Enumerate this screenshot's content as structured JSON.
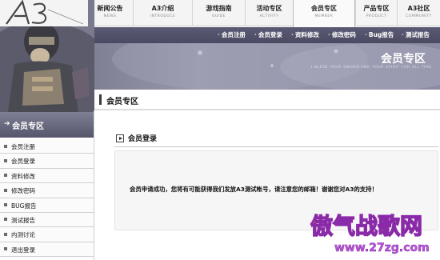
{
  "nav": {
    "items": [
      {
        "cn": "新闻公告",
        "en": "NEWS"
      },
      {
        "cn": "A3介绍",
        "en": "INTRODUCE"
      },
      {
        "cn": "游戏指南",
        "en": "GUIDE"
      },
      {
        "cn": "活动专区",
        "en": "ACTIVITY"
      },
      {
        "cn": "会员专区",
        "en": "MEMBER"
      },
      {
        "cn": "产品专区",
        "en": "PRODUCT"
      },
      {
        "cn": "A3社区",
        "en": "COMMUNITY"
      }
    ],
    "active_index": 4
  },
  "subnav": {
    "links": [
      "会员注册",
      "会员登录",
      "资料修改",
      "修改密码",
      "Bug报告",
      "测试报告"
    ]
  },
  "banner": {
    "title": "会员专区",
    "slogan": "I BLESS YOUR SWORD AND YOUR SPIRIT FOR ALL TIME"
  },
  "logo_text": "A3",
  "section": {
    "title": "会员专区"
  },
  "sidebar": {
    "title": "会员专区",
    "items": [
      "会员注册",
      "会员登录",
      "资料修改",
      "修改密码",
      "BUG报告",
      "测试报告",
      "内测讨论",
      "退出登录"
    ]
  },
  "main": {
    "login_title": "会员登录",
    "message": "会员申请成功，您将有可能获得我们发放A3测试帐号，请注意您的邮箱！谢谢您对A3的支持！"
  },
  "watermark": {
    "text_cn": "傲气战歌网",
    "url": "www.27zg.com"
  },
  "colors": {
    "banner_dark": "#55556c",
    "watermark_orange": "#f07d10",
    "watermark_purple": "#8a2aa8"
  }
}
